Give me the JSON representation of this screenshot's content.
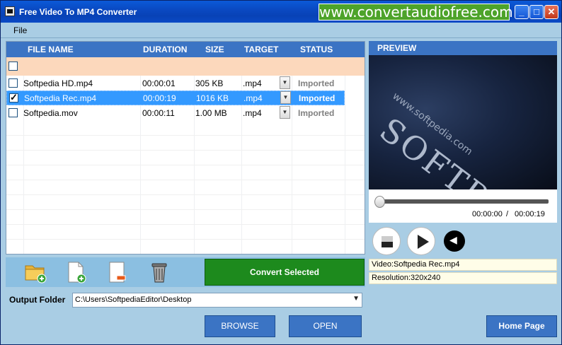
{
  "window": {
    "title": "Free Video To MP4 Converter",
    "banner": "www.convertaudiofree.com",
    "minimize": "_",
    "maximize": "□",
    "close": "✕"
  },
  "menu": {
    "file": "File"
  },
  "table": {
    "headers": {
      "file_name": "FILE NAME",
      "duration": "DURATION",
      "size": "SIZE",
      "target": "TARGET",
      "status": "STATUS"
    },
    "rows": [
      {
        "checked": false,
        "file_name": "Softpedia HD.mp4",
        "duration": "00:00:01",
        "size": "305 KB",
        "target": ".mp4",
        "status": "Imported"
      },
      {
        "checked": true,
        "file_name": "Softpedia Rec.mp4",
        "duration": "00:00:19",
        "size": "1016 KB",
        "target": ".mp4",
        "status": "Imported"
      },
      {
        "checked": false,
        "file_name": "Softpedia.mov",
        "duration": "00:00:11",
        "size": "1.00 MB",
        "target": ".mp4",
        "status": "Imported"
      }
    ]
  },
  "toolbar": {
    "add_folder_icon": "folder-add-icon",
    "add_file_icon": "file-add-icon",
    "remove_icon": "remove-icon",
    "delete_icon": "trash-icon",
    "convert_label": "Convert Selected",
    "convert_color": "#1d8a1d"
  },
  "output": {
    "label": "Output Folder",
    "path": "C:\\Users\\SoftpediaEditor\\Desktop",
    "browse_label": "BROWSE",
    "open_label": "OPEN"
  },
  "preview": {
    "header": "PREVIEW",
    "watermark_main": "SOFTPEDIA™",
    "watermark_url": "www.softpedia.com",
    "current_time": "00:00:00",
    "separator": "/",
    "duration": "00:00:19",
    "progress": 0,
    "video_info": "Video:Softpedia Rec.mp4",
    "resolution_info": "Resolution:320x240"
  },
  "home_page_label": "Home Page",
  "colors": {
    "accent": "#3b74c4",
    "selection": "#3399ff",
    "window_bg": "#a9cde4"
  }
}
